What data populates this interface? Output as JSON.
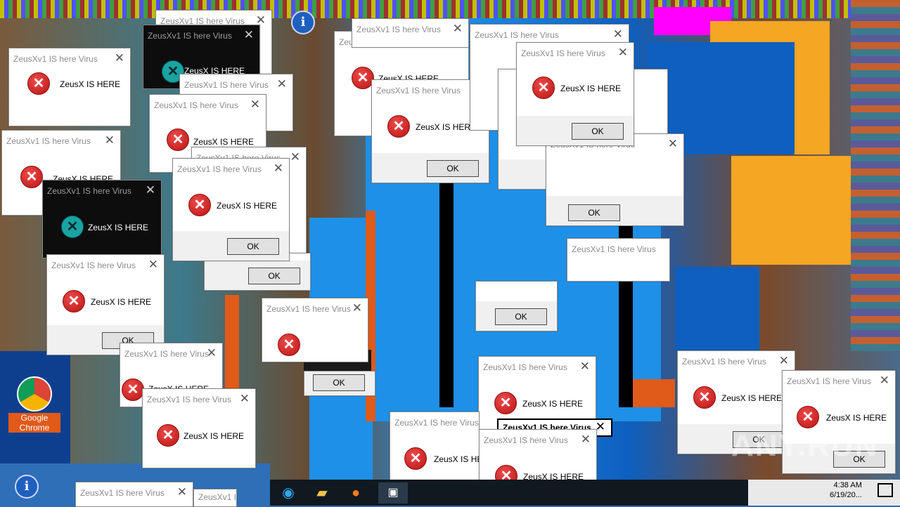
{
  "dialog": {
    "title": "ZeusXv1 IS here Virus",
    "message": "ZeusX IS HERE",
    "ok_label": "OK"
  },
  "dialog_alt_title": "ZeusXv1 IS here Virus",
  "dialog_bold_title": "ZeusXv1 IS here Virus",
  "desktop_icon": {
    "label": "Google Chrome"
  },
  "tray": {
    "time": "4:38 AM",
    "date": "6/19/20..."
  },
  "watermark": "ANY.RUN",
  "colors": {
    "error_red": "#c81e1e",
    "desktop_blue": "#1e90e8",
    "orange": "#f5a623",
    "magenta": "#ff00ff"
  },
  "icons": [
    "error-icon",
    "info-icon",
    "edge-icon",
    "file-explorer-icon",
    "firefox-icon",
    "window-icon",
    "chrome-icon",
    "notification-icon"
  ]
}
